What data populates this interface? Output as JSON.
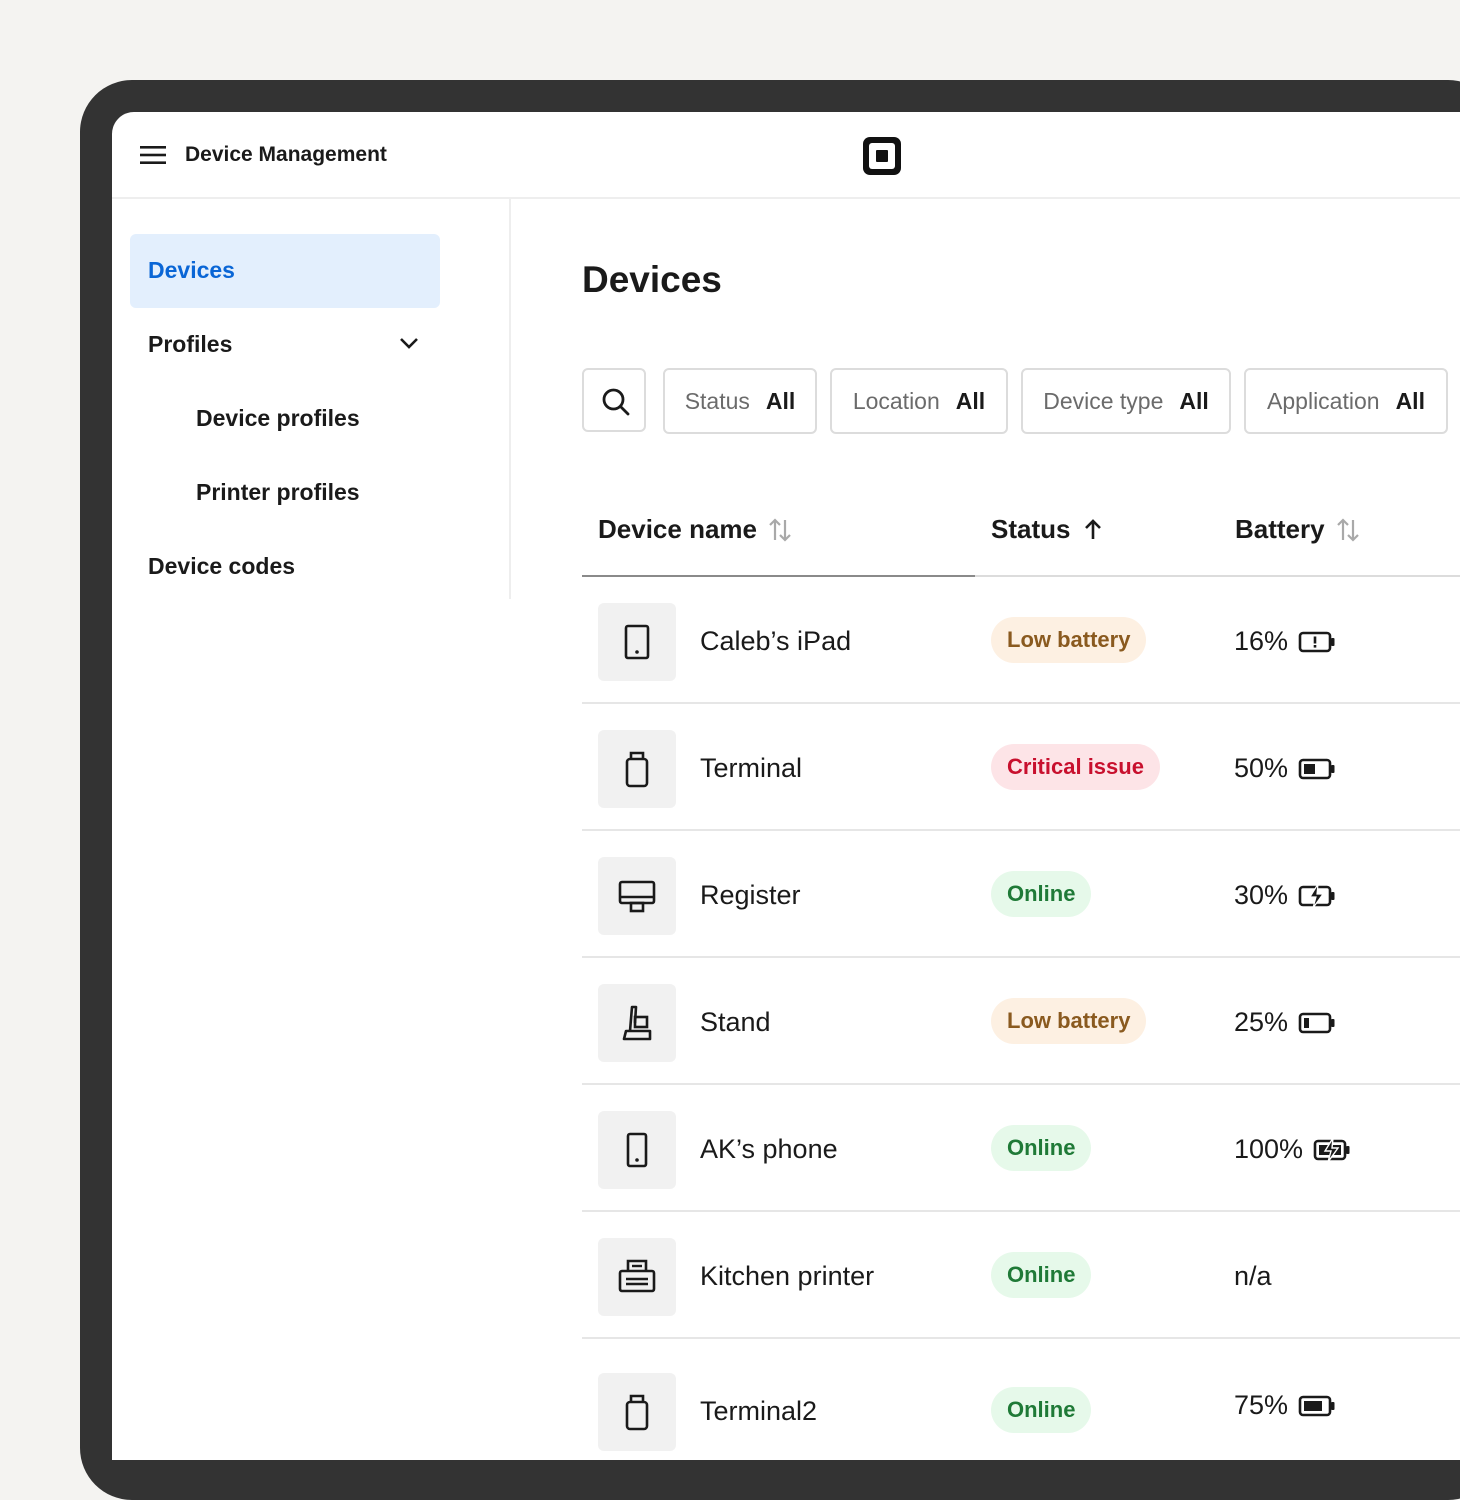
{
  "app": {
    "title": "Device Management"
  },
  "icons": {
    "menu": "hamburger-menu-icon",
    "logo": "square-logo-icon",
    "search": "search-icon"
  },
  "colors": {
    "accent": "#0a66d6",
    "active_nav_bg": "#e3effd",
    "low_battery_text": "#8a5a1f",
    "low_battery_bg": "#fdf0e2",
    "critical_text": "#c8102e",
    "critical_bg": "#fde4e7",
    "online_text": "#1f7a37",
    "online_bg": "#e6f9ea"
  },
  "sidebar": {
    "items": [
      {
        "label": "Devices",
        "active": true
      },
      {
        "label": "Profiles",
        "expanded": true
      },
      {
        "label": "Device profiles"
      },
      {
        "label": "Printer profiles"
      },
      {
        "label": "Device codes"
      }
    ]
  },
  "main": {
    "title": "Devices",
    "filters": [
      {
        "label": "Status",
        "value": "All"
      },
      {
        "label": "Location",
        "value": "All"
      },
      {
        "label": "Device type",
        "value": "All"
      },
      {
        "label": "Application",
        "value": "All"
      }
    ],
    "columns": [
      {
        "label": "Device name",
        "sort": "none"
      },
      {
        "label": "Status",
        "sort": "ascending"
      },
      {
        "label": "Battery",
        "sort": "none"
      }
    ],
    "rows": [
      {
        "icon": "tablet-icon",
        "name": "Caleb’s iPad",
        "status": "Low battery",
        "status_type": "warning",
        "battery": "16%",
        "battery_icon": "battery-alert-icon"
      },
      {
        "icon": "terminal-icon",
        "name": "Terminal",
        "status": "Critical issue",
        "status_type": "critical",
        "battery": "50%",
        "battery_icon": "battery-half-icon"
      },
      {
        "icon": "register-icon",
        "name": "Register",
        "status": "Online",
        "status_type": "success",
        "battery": "30%",
        "battery_icon": "battery-charging-icon"
      },
      {
        "icon": "stand-icon",
        "name": "Stand",
        "status": "Low battery",
        "status_type": "warning",
        "battery": "25%",
        "battery_icon": "battery-low-icon"
      },
      {
        "icon": "phone-icon",
        "name": "AK’s phone",
        "status": "Online",
        "status_type": "success",
        "battery": "100%",
        "battery_icon": "battery-full-charging-icon"
      },
      {
        "icon": "printer-icon",
        "name": "Kitchen printer",
        "status": "Online",
        "status_type": "success",
        "battery": "n/a",
        "battery_icon": ""
      },
      {
        "icon": "terminal-icon",
        "name": "Terminal2",
        "status": "Online",
        "status_type": "success",
        "battery": "75%",
        "battery_icon": "battery-three-quarter-icon"
      }
    ]
  }
}
